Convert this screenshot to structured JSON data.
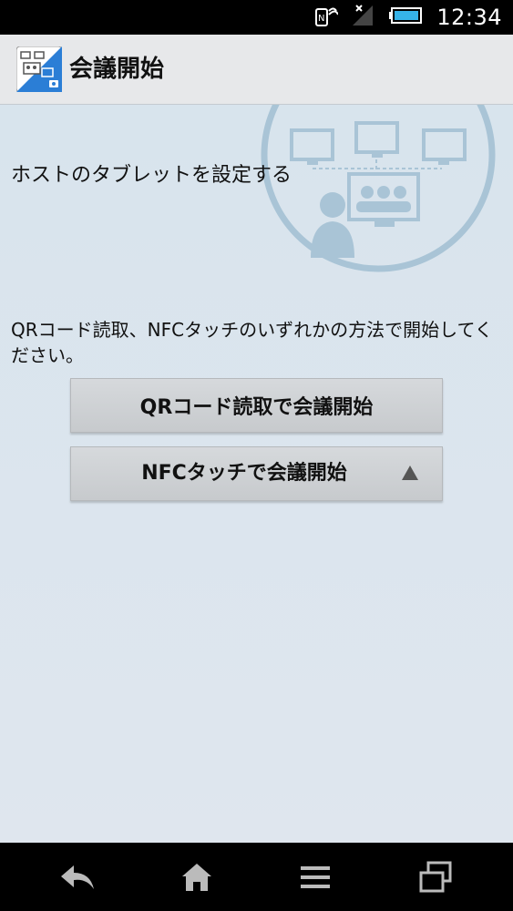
{
  "status_bar": {
    "time": "12:34",
    "icons": [
      "nfc-icon",
      "no-signal-icon",
      "battery-icon"
    ]
  },
  "action_bar": {
    "title": "会議開始",
    "icon": "app-icon"
  },
  "main": {
    "setup_heading": "ホストのタブレットを設定する",
    "instruction": "QRコード読取、NFCタッチのいずれかの方法で開始してください。",
    "qr_button_label": "QRコード読取で会議開始",
    "nfc_button_label": "NFCタッチで会議開始",
    "nfc_button_icon": "triangle-up-icon"
  },
  "nav_bar": {
    "buttons": [
      "back-icon",
      "home-icon",
      "menu-icon",
      "recent-apps-icon"
    ]
  },
  "colors": {
    "background": "#dce6ee",
    "illustration": "#a9c4d6",
    "button": "#cfd2d5"
  }
}
